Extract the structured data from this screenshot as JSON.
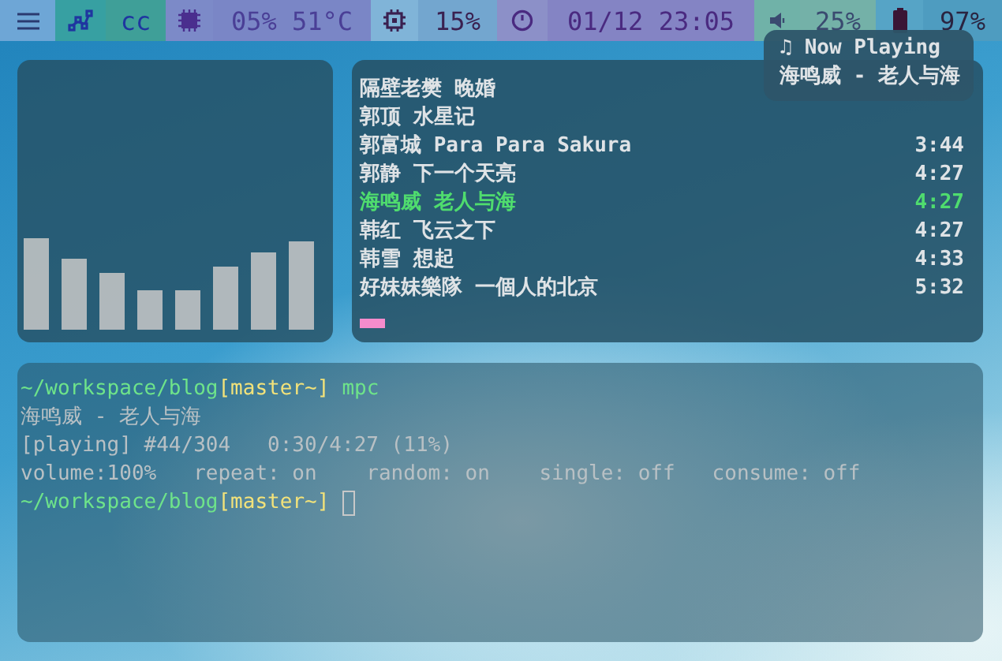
{
  "status_bar": {
    "segments": [
      {
        "kind": "menu"
      },
      {
        "kind": "network",
        "text": "cc"
      },
      {
        "kind": "memory",
        "text": "05% 51°C"
      },
      {
        "kind": "cpu",
        "text": "15%"
      },
      {
        "kind": "clock",
        "text": "01/12 23:05"
      },
      {
        "kind": "volume",
        "text": "25%"
      },
      {
        "kind": "battery",
        "text": "97%"
      }
    ]
  },
  "playlist": {
    "rows": [
      {
        "title": "隔壁老樊 晚婚",
        "selected": false
      },
      {
        "title": "郭顶 水星记",
        "selected": false
      },
      {
        "title": "郭富城 Para Para Sakura",
        "time": "3:44",
        "selected": false
      },
      {
        "title": "郭静 下一个天亮",
        "time": "4:27",
        "selected": false
      },
      {
        "title": "海鸣威 老人与海",
        "time": "4:27",
        "selected": true
      },
      {
        "title": "韩红 飞云之下",
        "time": "4:27",
        "selected": false
      },
      {
        "title": "韩雪 想起",
        "time": "4:33",
        "selected": false
      },
      {
        "title": "好妹妹樂隊 一個人的北京",
        "time": "5:32",
        "selected": false
      }
    ]
  },
  "now_playing": {
    "icon": "♫",
    "title": "Now Playing",
    "track": "海鸣威 - 老人与海"
  },
  "terminal": {
    "lines": [
      {
        "kind": "prompt",
        "path": "~/workspace/blog",
        "branch": "[master~]",
        "command": "mpc"
      },
      {
        "kind": "output",
        "text": "海鸣威 - 老人与海"
      },
      {
        "kind": "output",
        "text": "[playing] #44/304   0:30/4:27 (11%)"
      },
      {
        "kind": "output",
        "text": "volume:100%   repeat: on    random: on    single: off   consume: off"
      },
      {
        "kind": "prompt",
        "path": "~/workspace/blog",
        "branch": "[master~]",
        "cursor": true
      }
    ]
  }
}
